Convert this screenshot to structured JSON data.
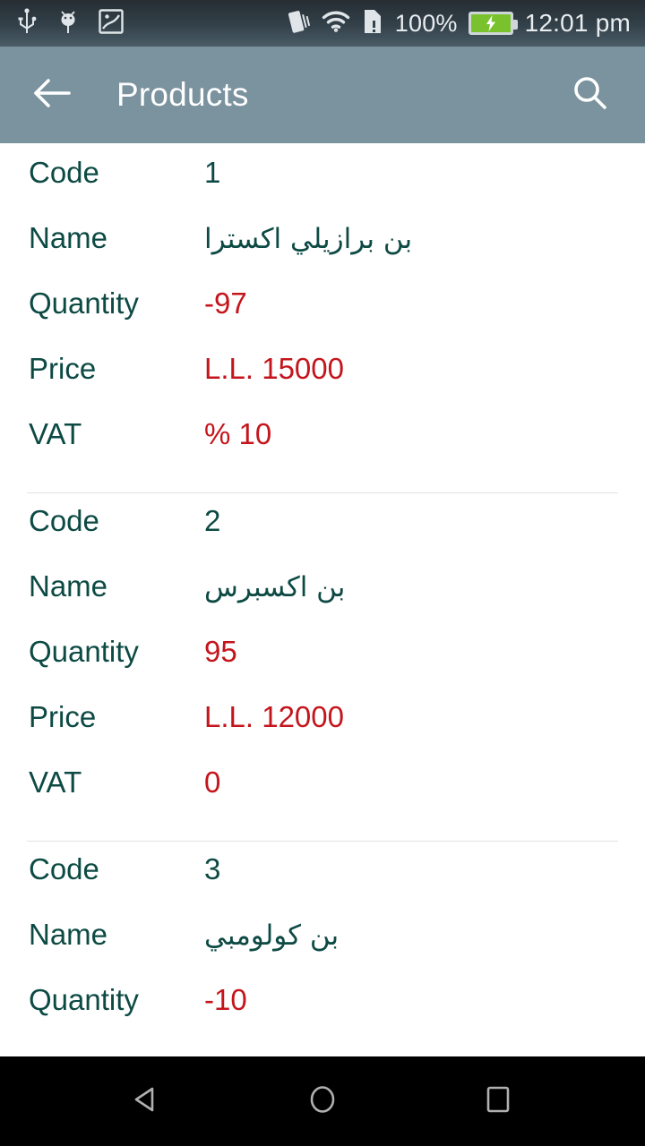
{
  "status_bar": {
    "left_icons": [
      "usb-icon",
      "android-debug-icon",
      "screenshot-image-icon"
    ],
    "right_icons": [
      "vibrate-icon",
      "wifi-icon",
      "sim-card-alert-icon"
    ],
    "battery_percent": "100%",
    "battery_state": "charging",
    "clock": "12:01 pm"
  },
  "app_bar": {
    "back_icon": "arrow-left-icon",
    "title": "Products",
    "search_icon": "search-icon"
  },
  "labels": {
    "code": "Code",
    "name": "Name",
    "quantity": "Quantity",
    "price": "Price",
    "vat": "VAT"
  },
  "colors": {
    "app_bar": "#7a939e",
    "label_text": "#0d4a44",
    "value_teal": "#0d4a44",
    "value_red": "#c4151c",
    "battery_green": "#79c22e",
    "divider": "#e2e2e2"
  },
  "products": [
    {
      "code": "1",
      "name": "بن برازيلي اكسترا",
      "quantity": "-97",
      "price": "L.L. 15000",
      "vat": "% 10"
    },
    {
      "code": "2",
      "name": "بن اكسبرس",
      "quantity": "95",
      "price": "L.L. 12000",
      "vat": "0"
    },
    {
      "code": "3",
      "name": "بن كولومبي",
      "quantity": "-10",
      "price": "",
      "vat": ""
    }
  ],
  "nav_bar": {
    "back": "nav-back-icon",
    "home": "nav-home-icon",
    "recents": "nav-recents-icon"
  }
}
